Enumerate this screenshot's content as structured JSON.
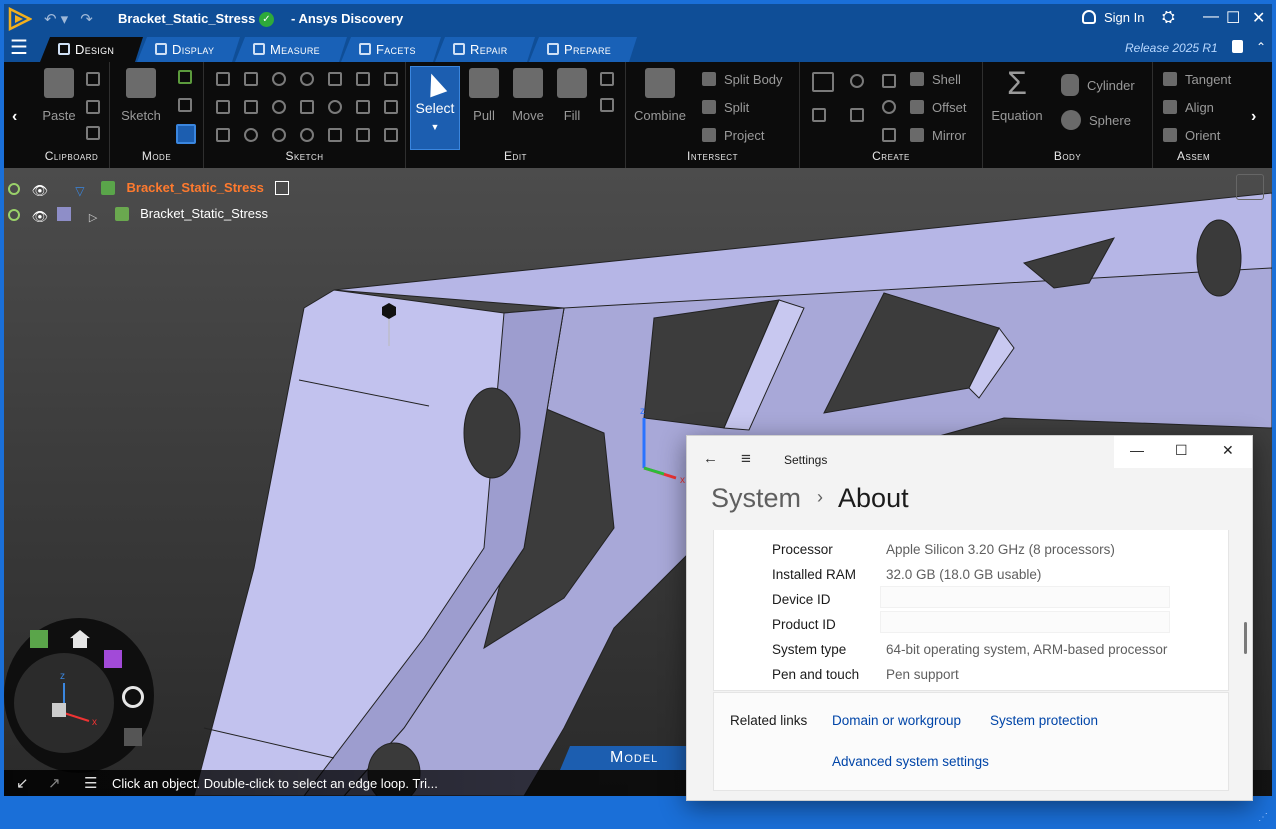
{
  "ansys": {
    "document_title": "Bracket_Static_Stress",
    "app_title": "- Ansys Discovery",
    "sign_in": "Sign In",
    "release": "Release 2025 R1",
    "tabs": [
      {
        "label": "Design",
        "active": true
      },
      {
        "label": "Display",
        "active": false
      },
      {
        "label": "Measure",
        "active": false
      },
      {
        "label": "Facets",
        "active": false
      },
      {
        "label": "Repair",
        "active": false
      },
      {
        "label": "Prepare",
        "active": false
      }
    ],
    "ribbon": {
      "groups": [
        "Clipboard",
        "Mode",
        "Sketch",
        "Edit",
        "Intersect",
        "Create",
        "Body",
        "Assem"
      ],
      "paste": "Paste",
      "sketch": "Sketch",
      "select": "Select",
      "pull": "Pull",
      "move": "Move",
      "fill": "Fill",
      "combine": "Combine",
      "split_body": "Split Body",
      "split": "Split",
      "project": "Project",
      "shell": "Shell",
      "offset": "Offset",
      "mirror": "Mirror",
      "equation": "Equation",
      "cylinder": "Cylinder",
      "sphere": "Sphere",
      "tangent": "Tangent",
      "align": "Align",
      "orient": "Orient"
    },
    "tree": {
      "root": "Bracket_Static_Stress",
      "child": "Bracket_Static_Stress"
    },
    "model_tab": "Model",
    "status_message": "Click an object. Double-click to select an edge loop. Tri...",
    "accent": "#1c5eb0"
  },
  "settings": {
    "app_title": "Settings",
    "breadcrumb_parent": "System",
    "breadcrumb_current": "About",
    "specs": [
      {
        "key": "Processor",
        "value": "Apple Silicon   3.20 GHz  (8 processors)"
      },
      {
        "key": "Installed RAM",
        "value": "32.0 GB (18.0 GB usable)"
      },
      {
        "key": "Device ID",
        "value": ""
      },
      {
        "key": "Product ID",
        "value": ""
      },
      {
        "key": "System type",
        "value": "64-bit operating system, ARM-based processor"
      },
      {
        "key": "Pen and touch",
        "value": "Pen support"
      }
    ],
    "related_links_label": "Related links",
    "links": [
      "Domain or workgroup",
      "System protection",
      "Advanced system settings"
    ],
    "link_color": "#0045a8"
  }
}
